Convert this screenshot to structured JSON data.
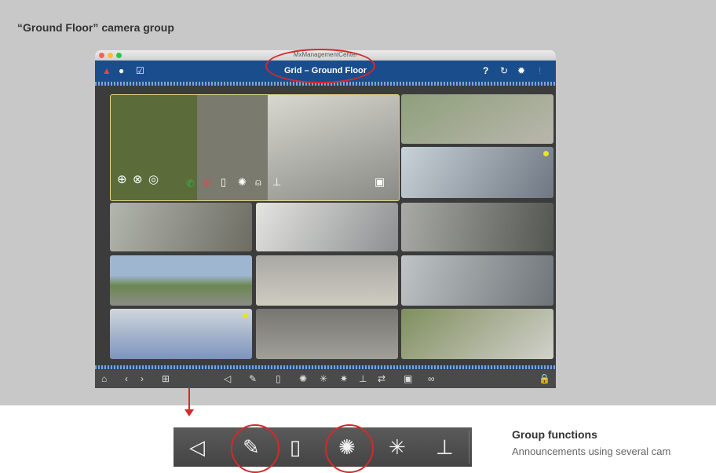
{
  "caption": "“Ground Floor” camera group",
  "window": {
    "app_title": "MxManagementCenter",
    "view_title": "Grid – Ground Floor",
    "top_icons": [
      "alarm-bell-icon",
      "chat-icon",
      "checkbox-icon"
    ],
    "right_icons": [
      "help-icon",
      "refresh-icon",
      "settings-icon",
      "info-icon"
    ]
  },
  "cameras": [
    "camera-large-staircase",
    "camera-outdoor-parking",
    "camera-hallway",
    "camera-office-1",
    "camera-atrium",
    "camera-facade",
    "camera-outdoor-lake",
    "camera-lecture-hall",
    "camera-parking-lot",
    "camera-office-2",
    "camera-lobby",
    "camera-staircase-2"
  ],
  "bottom_toolbar_icons": [
    "home-icon",
    "back-icon",
    "forward-icon",
    "layout-icon",
    "speaker-icon",
    "microphone-icon",
    "door-icon",
    "light-icon",
    "light-off-icon",
    "light-disabled-icon",
    "thermometer-icon",
    "switch-icon",
    "snapshot-icon",
    "link-icon",
    "lock-icon"
  ],
  "group_toolbar_icons": [
    "speaker-icon",
    "microphone-icon",
    "door-icon",
    "light-icon",
    "light-off-icon",
    "thermometer-icon"
  ],
  "group_functions": {
    "title": "Group functions",
    "description": "Announcements using several cam"
  },
  "colors": {
    "accent_blue": "#1a4d8c",
    "highlight_red": "#d42a2a",
    "panel_grey": "#c8c8c8"
  }
}
